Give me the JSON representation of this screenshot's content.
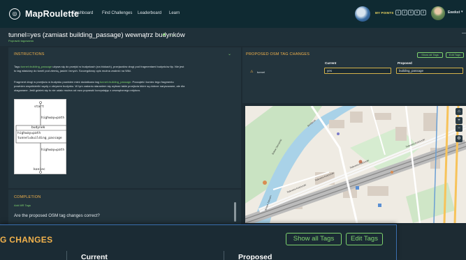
{
  "app": {
    "name": "MapRoulette",
    "logo_icon": "maproulette-logo-icon"
  },
  "nav": {
    "dashboard": "Dashboard",
    "find_challenges": "Find Challenges",
    "leaderboard": "Leaderboard",
    "learn": "Learn"
  },
  "user": {
    "points_label": "MY POINTS",
    "points_digits": [
      "1",
      "2",
      "0",
      "6",
      "2"
    ],
    "name": "Ewekst"
  },
  "task": {
    "title": "tunnel=yes (zamiast building_passage) wewnątrz budynków",
    "subtitle": "Poprawki tagowania"
  },
  "instructions": {
    "heading": "INSTRUCTIONS",
    "p1_a": "Tagu ",
    "p1_code": "tunnel=building_passage",
    "p1_b": " używa się do przejść w budynkach (na blokach), przejazdów drogi pod fragmentami budynków itp. Nie jest",
    "p1_c": "to tag właściwy do tuneli pod ziemią, jaskiń i innych. Szczegółowy opis można znaleźć na Wiki.",
    "p2_a": "Fragment drogi w przejściu w budynku powinien mieć dodatkowo tag ",
    "p2_code": "tunnel=building_passage",
    "p2_b": ". Początek i koniec tego fragmentu",
    "p2_c": "powinien współdzielić węzły z obrysem budynku. W tym zadaniu staraniem się wybrać takie przejścia które są dobrze narysowane, ale dla",
    "p2_d": "otagowane. Jeśli gdzieś się to nie udało można od razu poprawić korzystając z zewnętrznego edytora."
  },
  "diagram": {
    "start": "start",
    "upper_tag": "highway=path",
    "building": "budynek",
    "inner_tag1": "highway=path",
    "inner_tag2": "tunnel=building_passage",
    "lower_tag": "highway=path",
    "end": "koniec"
  },
  "completion": {
    "heading": "COMPLETION",
    "add_mr_tags": "Add MR Tags",
    "question": "Are the proposed OSM tag changes correct?"
  },
  "osm_changes": {
    "heading": "PROPOSED OSM TAG CHANGES",
    "show_all_tags": "Show all Tags",
    "edit_tags": "Edit Tags",
    "col_current": "Current",
    "col_proposed": "Proposed",
    "rows": [
      {
        "tag": "tunnel",
        "current": "yes",
        "proposed": "building_passage"
      }
    ]
  },
  "map": {
    "street_labels": [
      "Tadeusza Kościuszki",
      "Tadeusza Kościuszki",
      "Tadeusza Kościuszki",
      "Tadeusza Kościuszki",
      "Bulwar Zacnychki",
      "Bulwar Zacnych",
      "Sweiłycza"
    ],
    "controls": [
      "⌂",
      "+",
      "−",
      "⚙"
    ]
  },
  "overlay": {
    "heading": "G CHANGES",
    "show_all_tags": "Show all Tags",
    "edit_tags": "Edit Tags",
    "col_current": "Current",
    "col_proposed": "Proposed"
  },
  "colors": {
    "accent_green": "#7ed36e",
    "accent_orange": "#f2b24c",
    "topbar": "#0f2a32",
    "panel": "#23343d",
    "overlay_border": "#3b6fb0"
  }
}
